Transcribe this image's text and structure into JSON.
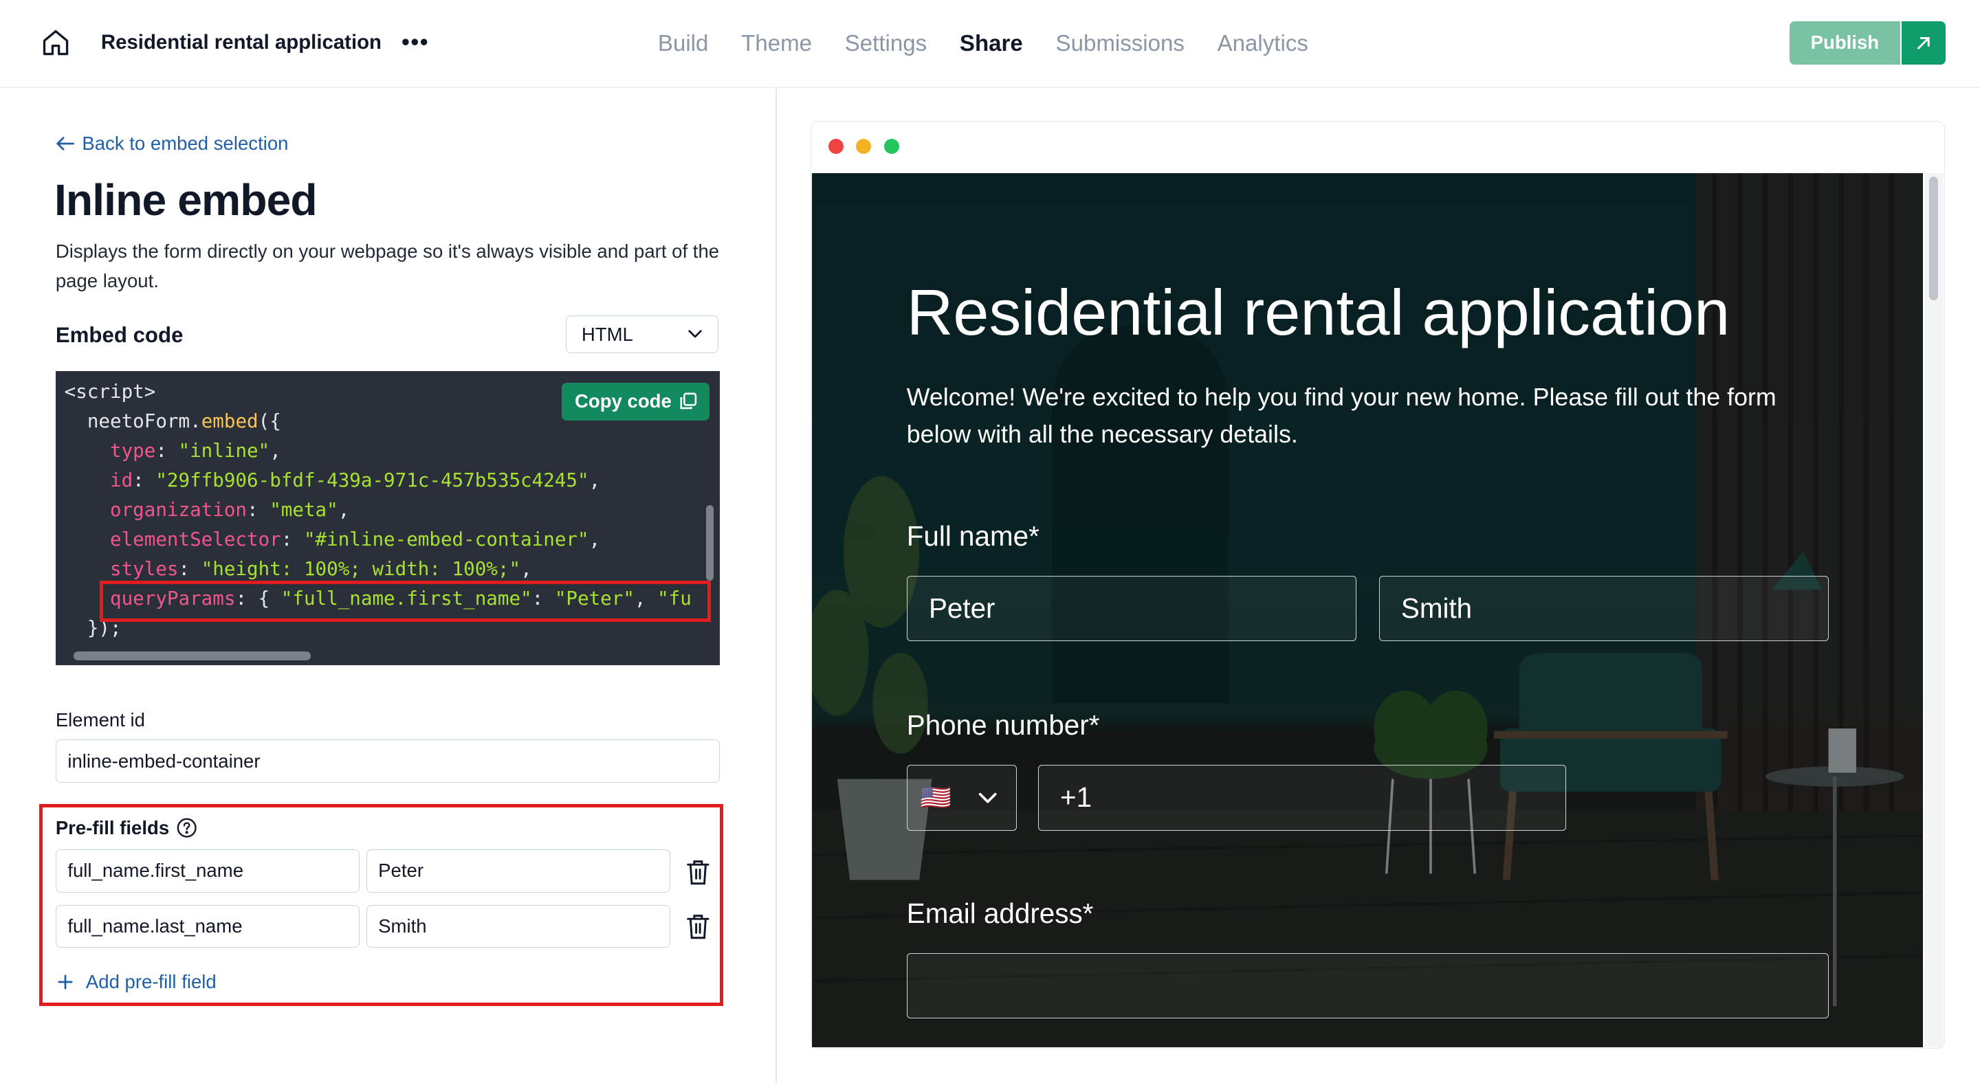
{
  "header": {
    "app_title": "Residential rental application",
    "more": "•••",
    "nav": [
      "Build",
      "Theme",
      "Settings",
      "Share",
      "Submissions",
      "Analytics"
    ],
    "active_nav": "Share",
    "publish_label": "Publish",
    "icons": {
      "home": "home-icon",
      "more": "more-horizontal-icon",
      "external": "external-link-icon"
    }
  },
  "left": {
    "back_link": "Back to embed selection",
    "title": "Inline embed",
    "description": "Displays the form directly on your webpage so it's always visible and part of the page layout.",
    "embed_code_label": "Embed code",
    "format_selected": "HTML",
    "copy_code_label": "Copy code",
    "code": {
      "line_script": "<script>",
      "line_call_obj": "neetoForm",
      "line_call_fn": "embed",
      "line_call_tail": "({",
      "type_key": "type",
      "type_val": "\"inline\"",
      "id_key": "id",
      "id_val": "\"29ffb906-bfdf-439a-971c-457b535c4245\"",
      "org_key": "organization",
      "org_val": "\"meta\"",
      "sel_key": "elementSelector",
      "sel_val": "\"#inline-embed-container\"",
      "styles_key": "styles",
      "styles_val": "\"height: 100%; width: 100%;\"",
      "qp_key": "queryParams",
      "qp_k1": "\"full_name.first_name\"",
      "qp_v1": "\"Peter\"",
      "qp_k2": "\"fu",
      "close": "});"
    },
    "element_id_label": "Element id",
    "element_id_value": "inline-embed-container",
    "prefill_label": "Pre-fill fields",
    "prefill_fields": [
      {
        "key": "full_name.first_name",
        "value": "Peter"
      },
      {
        "key": "full_name.last_name",
        "value": "Smith"
      }
    ],
    "add_prefill_label": "Add pre-fill field"
  },
  "preview": {
    "form_title": "Residential rental application",
    "form_description": "Welcome! We're excited to help you find your new home. Please fill out the form below with all the necessary details.",
    "full_name_label": "Full name*",
    "first_name_value": "Peter",
    "last_name_value": "Smith",
    "phone_label": "Phone number*",
    "phone_flag": "🇺🇸",
    "phone_value": "+1",
    "email_label": "Email address*",
    "email_value": ""
  },
  "colors": {
    "accent_green": "#138a5e",
    "publish_disabled": "#79c2a4",
    "link_blue": "#1f5fa8",
    "highlight_red": "#e11d1d"
  }
}
